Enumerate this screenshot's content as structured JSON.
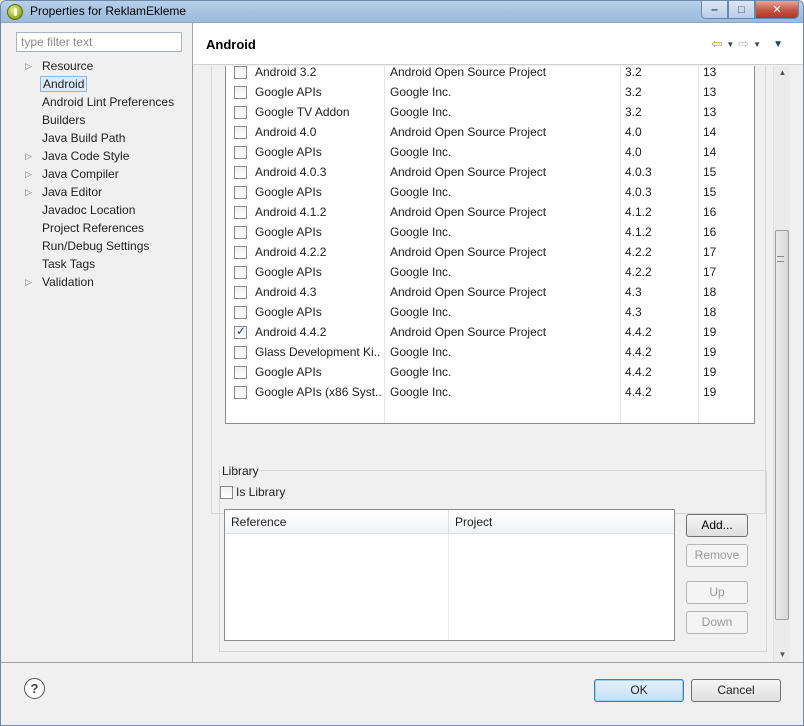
{
  "window": {
    "title": "Properties for ReklamEkleme"
  },
  "filter": {
    "placeholder": "type filter text"
  },
  "tree": [
    {
      "label": "Resource",
      "expandable": true
    },
    {
      "label": "Android",
      "expandable": false,
      "selected": true
    },
    {
      "label": "Android Lint Preferences",
      "expandable": false
    },
    {
      "label": "Builders",
      "expandable": false
    },
    {
      "label": "Java Build Path",
      "expandable": false
    },
    {
      "label": "Java Code Style",
      "expandable": true
    },
    {
      "label": "Java Compiler",
      "expandable": true
    },
    {
      "label": "Java Editor",
      "expandable": true
    },
    {
      "label": "Javadoc Location",
      "expandable": false
    },
    {
      "label": "Project References",
      "expandable": false
    },
    {
      "label": "Run/Debug Settings",
      "expandable": false
    },
    {
      "label": "Task Tags",
      "expandable": false
    },
    {
      "label": "Validation",
      "expandable": true
    }
  ],
  "header": {
    "title": "Android"
  },
  "targets": [
    {
      "name": "Android 3.2",
      "vendor": "Android Open Source Project",
      "platform": "3.2",
      "api": "13",
      "checked": false
    },
    {
      "name": "Google APIs",
      "vendor": "Google Inc.",
      "platform": "3.2",
      "api": "13",
      "checked": false
    },
    {
      "name": "Google TV Addon",
      "vendor": "Google Inc.",
      "platform": "3.2",
      "api": "13",
      "checked": false
    },
    {
      "name": "Android 4.0",
      "vendor": "Android Open Source Project",
      "platform": "4.0",
      "api": "14",
      "checked": false
    },
    {
      "name": "Google APIs",
      "vendor": "Google Inc.",
      "platform": "4.0",
      "api": "14",
      "checked": false
    },
    {
      "name": "Android 4.0.3",
      "vendor": "Android Open Source Project",
      "platform": "4.0.3",
      "api": "15",
      "checked": false
    },
    {
      "name": "Google APIs",
      "vendor": "Google Inc.",
      "platform": "4.0.3",
      "api": "15",
      "checked": false
    },
    {
      "name": "Android 4.1.2",
      "vendor": "Android Open Source Project",
      "platform": "4.1.2",
      "api": "16",
      "checked": false
    },
    {
      "name": "Google APIs",
      "vendor": "Google Inc.",
      "platform": "4.1.2",
      "api": "16",
      "checked": false
    },
    {
      "name": "Android 4.2.2",
      "vendor": "Android Open Source Project",
      "platform": "4.2.2",
      "api": "17",
      "checked": false
    },
    {
      "name": "Google APIs",
      "vendor": "Google Inc.",
      "platform": "4.2.2",
      "api": "17",
      "checked": false
    },
    {
      "name": "Android 4.3",
      "vendor": "Android Open Source Project",
      "platform": "4.3",
      "api": "18",
      "checked": false
    },
    {
      "name": "Google APIs",
      "vendor": "Google Inc.",
      "platform": "4.3",
      "api": "18",
      "checked": false
    },
    {
      "name": "Android 4.4.2",
      "vendor": "Android Open Source Project",
      "platform": "4.4.2",
      "api": "19",
      "checked": true
    },
    {
      "name": "Glass Development Ki...",
      "vendor": "Google Inc.",
      "platform": "4.4.2",
      "api": "19",
      "checked": false
    },
    {
      "name": "Google APIs",
      "vendor": "Google Inc.",
      "platform": "4.4.2",
      "api": "19",
      "checked": false
    },
    {
      "name": "Google APIs (x86 Syst...",
      "vendor": "Google Inc.",
      "platform": "4.4.2",
      "api": "19",
      "checked": false
    }
  ],
  "library": {
    "legend": "Library",
    "is_library_label": "Is Library",
    "col_reference": "Reference",
    "col_project": "Project",
    "add_label": "Add...",
    "remove_label": "Remove",
    "up_label": "Up",
    "down_label": "Down"
  },
  "footer": {
    "ok_label": "OK",
    "cancel_label": "Cancel",
    "help_glyph": "?"
  }
}
